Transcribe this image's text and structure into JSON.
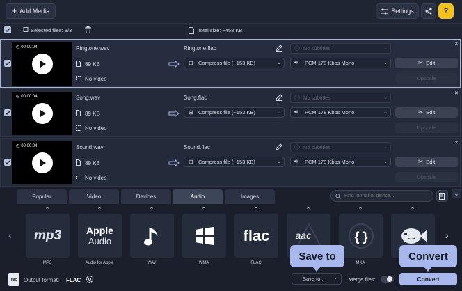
{
  "toolbar": {
    "add_media": "Add Media",
    "settings": "Settings",
    "help": "?"
  },
  "selection": {
    "selected_label": "Selected files: 3/3",
    "total_size": "Total size: ~458 KB"
  },
  "files": [
    {
      "time": "00:00:04",
      "name": "Ringtone.wav",
      "size": "89 KB",
      "video": "No video",
      "output_name": "Ringtone.flac",
      "subtitles": "No subtitles",
      "compress": "Compress file (~153 KB)",
      "audio": "PCM 178 Kbps Mono",
      "edit": "Edit",
      "upscale": "Upscale"
    },
    {
      "time": "00:00:04",
      "name": "Song.wav",
      "size": "89 KB",
      "video": "No video",
      "output_name": "Song.flac",
      "subtitles": "No subtitles",
      "compress": "Compress file (~153 KB)",
      "audio": "PCM 178 Kbps Mono",
      "edit": "Edit",
      "upscale": "Upscale"
    },
    {
      "time": "00:00:04",
      "name": "Sound.wav",
      "size": "89 KB",
      "video": "No video",
      "output_name": "Sound.flac",
      "subtitles": "No subtitles",
      "compress": "Compress file (~153 KB)",
      "audio": "PCM 178 Kbps Mono",
      "edit": "Edit",
      "upscale": "Upscale"
    }
  ],
  "tabs": [
    "Popular",
    "Video",
    "Devices",
    "Audio",
    "Images"
  ],
  "active_tab": "Audio",
  "search": {
    "placeholder": "Find format or device..."
  },
  "formats": [
    {
      "label": "MP3",
      "icon": "mp3"
    },
    {
      "label": "Audio for Apple",
      "icon": "Apple Audio"
    },
    {
      "label": "WAV",
      "icon": "music-note-icon"
    },
    {
      "label": "WMA",
      "icon": "windows-icon"
    },
    {
      "label": "FLAC",
      "icon": "flac"
    },
    {
      "label": "",
      "icon": "aac"
    },
    {
      "label": "MKA",
      "icon": "braces-icon"
    },
    {
      "label": "",
      "icon": "ogg-fish-icon"
    }
  ],
  "format_logos": {
    "mp3": "mp3",
    "apple1": "Apple",
    "apple2": "Audio",
    "flac": "flac",
    "aac": "aac"
  },
  "footer": {
    "badge": "flac",
    "output_label": "Output format:",
    "output_value": "FLAC",
    "save_to": "Save to...",
    "merge": "Merge files:",
    "convert": "Convert"
  },
  "callouts": {
    "save_to": "Save to",
    "convert": "Convert"
  },
  "colors": {
    "accent": "#a9b8ec",
    "background": "#1f2533",
    "panel": "#1a1f2b"
  }
}
